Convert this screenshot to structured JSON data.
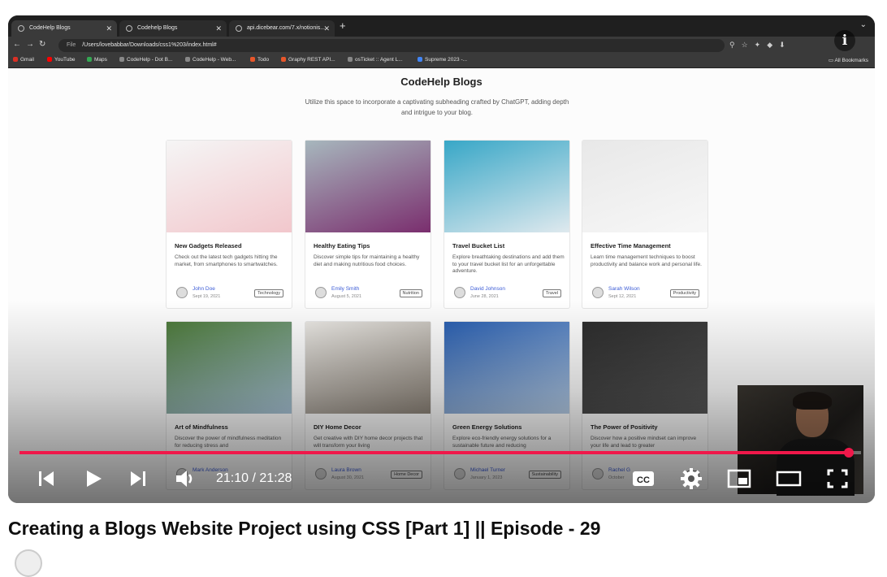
{
  "browser": {
    "tabs": [
      {
        "label": "CodeHelp Blogs",
        "active": true
      },
      {
        "label": "Codehelp Blogs",
        "active": false
      },
      {
        "label": "api.dicebear.com/7.x/notionis...",
        "active": false
      }
    ],
    "file_label": "File",
    "url": "/Users/lovebabbar/Downloads/css1%203/index.html#",
    "bookmarks": [
      "Gmail",
      "YouTube",
      "Maps",
      "CodeHelp - Dot B...",
      "CodeHelp - Web...",
      "Todo",
      "Graphy REST API...",
      "osTicket :: Agent L...",
      "Supreme 2023 -..."
    ],
    "all_bookmarks": "All Bookmarks"
  },
  "page": {
    "title": "CodeHelp Blogs",
    "subtitle": "Utilize this space to incorporate a captivating subheading crafted by ChatGPT, adding depth and intrigue to your blog."
  },
  "cards": [
    {
      "title": "New Gadgets Released",
      "desc": "Check out the latest tech gadgets hitting the market, from smartphones to smartwatches.",
      "author": "John Doe",
      "date": "Sept 19, 2021",
      "tag": "Technology",
      "img_a": "#f5f5f5",
      "img_b": "#f2c7cc"
    },
    {
      "title": "Healthy Eating Tips",
      "desc": "Discover simple tips for maintaining a healthy diet and making nutritious food choices.",
      "author": "Emily Smith",
      "date": "August 5, 2021",
      "tag": "Nutrition",
      "img_a": "#a7b7bd",
      "img_b": "#7a2e6e"
    },
    {
      "title": "Travel Bucket List",
      "desc": "Explore breathtaking destinations and add them to your travel bucket list for an unforgettable adventure.",
      "author": "David Johnson",
      "date": "June 28, 2021",
      "tag": "Travel",
      "img_a": "#38a7c7",
      "img_b": "#dfe9ee"
    },
    {
      "title": "Effective Time Management",
      "desc": "Learn time management techniques to boost productivity and balance work and personal life.",
      "author": "Sarah Wilson",
      "date": "Sept 12, 2021",
      "tag": "Productivity",
      "img_a": "#e8e8e8",
      "img_b": "#f7f7f7"
    },
    {
      "title": "Art of Mindfulness",
      "desc": "Discover the power of mindfulness meditation for reducing stress and",
      "author": "Mark Anderson",
      "date": "",
      "tag": "",
      "img_a": "#4d7a3a",
      "img_b": "#a9c4d8"
    },
    {
      "title": "DIY Home Decor",
      "desc": "Get creative with DIY home decor projects that will transform your living",
      "author": "Laura Brown",
      "date": "August 30, 2021",
      "tag": "Home Decor",
      "img_a": "#e8e6e2",
      "img_b": "#8c8378"
    },
    {
      "title": "Green Energy Solutions",
      "desc": "Explore eco-friendly energy solutions for a sustainable future and reducing",
      "author": "Michael Turner",
      "date": "January 1, 2023",
      "tag": "Sustainability",
      "img_a": "#2a5fb0",
      "img_b": "#b6cde6"
    },
    {
      "title": "The Power of Positivity",
      "desc": "Discover how a positive mindset can improve your life and lead to greater",
      "author": "Rachel G",
      "date": "October",
      "tag": "Po",
      "img_a": "#2d2d2d",
      "img_b": "#555555"
    }
  ],
  "player": {
    "time_display": "21:10 / 21:28",
    "progress_fraction": 0.986,
    "accent": "#f0184a",
    "icons": [
      "previous-icon",
      "play-icon",
      "next-icon",
      "volume-icon",
      "cc-icon",
      "settings-icon",
      "miniplayer-icon",
      "theater-icon",
      "fullscreen-icon",
      "info-icon"
    ]
  },
  "video": {
    "title": "Creating a Blogs Website Project using CSS [Part 1] || Episode - 29"
  }
}
